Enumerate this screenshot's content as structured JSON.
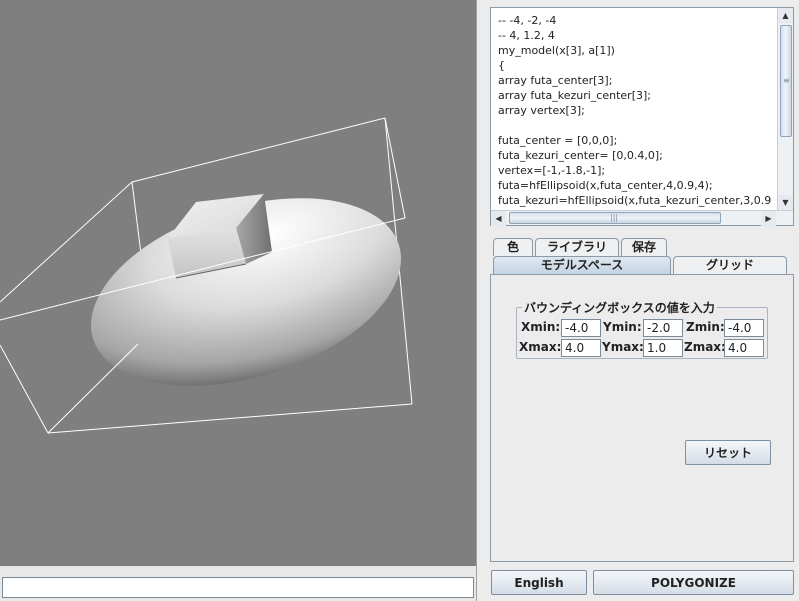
{
  "code_editor": {
    "lines": [
      "-- -4, -2, -4",
      "-- 4, 1.2, 4",
      "my_model(x[3], a[1])",
      "{",
      "array futa_center[3];",
      "array futa_kezuri_center[3];",
      "array vertex[3];",
      "",
      "futa_center = [0,0,0];",
      "futa_kezuri_center= [0,0.4,0];",
      "vertex=[-1,-1.8,-1];",
      "futa=hfEllipsoid(x,futa_center,4,0.9,4);",
      "futa_kezuri=hfEllipsoid(x,futa_kezuri_center,3,0.9"
    ]
  },
  "tabs_row1": [
    "色",
    "ライブラリ",
    "保存"
  ],
  "tabs_row2": [
    "モデルスペース",
    "グリッド"
  ],
  "active_tab": "モデルスペース",
  "bounding_box": {
    "title": "バウンディングボックスの値を入力",
    "xmin_label": "Xmin:",
    "xmin": "-4.0",
    "ymin_label": "Ymin:",
    "ymin": "-2.0",
    "zmin_label": "Zmin:",
    "zmin": "-4.0",
    "xmax_label": "Xmax:",
    "xmax": "4.0",
    "ymax_label": "Ymax:",
    "ymax": "1.0",
    "zmax_label": "Zmax:",
    "zmax": "4.0"
  },
  "reset_label": "リセット",
  "english_label": "English",
  "polygonize_label": "POLYGONIZE",
  "command_input": "",
  "colors": {
    "viewport_bg": "#7f7f7f",
    "accent": "#c8d7e6"
  }
}
